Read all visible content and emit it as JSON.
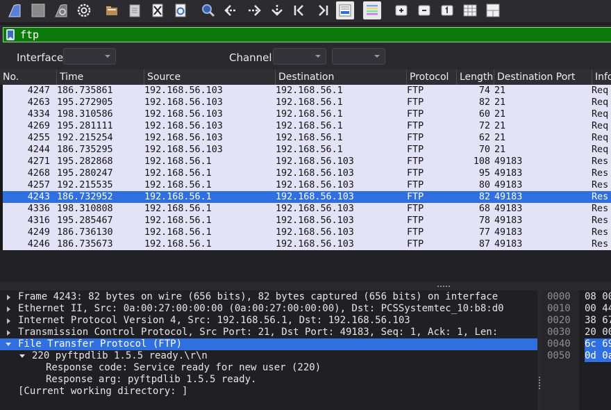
{
  "toolbar": {
    "icons": [
      "shark-fin-start-icon",
      "stop-square-icon",
      "shark-fin-restart-icon",
      "gear-options-icon",
      "open-folder-icon",
      "save-file-icon",
      "close-file-icon",
      "reload-file-icon",
      "find-magnifier-icon",
      "go-back-icon",
      "go-forward-icon",
      "go-to-packet-icon",
      "first-packet-icon",
      "last-packet-icon",
      "autoscroll-icon",
      "colorize-icon",
      "zoom-in-icon",
      "zoom-out-icon",
      "normal-size-icon",
      "resize-columns-icon",
      "layout-icon"
    ]
  },
  "filter": {
    "value": "ftp"
  },
  "interface_bar": {
    "interface_label": "Interface",
    "channel_label": "Channel",
    "interface_value": "",
    "channel_value": "",
    "channel_width_value": ""
  },
  "packet_list": {
    "columns": [
      "No.",
      "Time",
      "Source",
      "Destination",
      "Protocol",
      "Length",
      "Destination Port",
      "Info"
    ],
    "rows": [
      {
        "no": "4247",
        "time": "186.735861",
        "src": "192.168.56.103",
        "dst": "192.168.56.1",
        "proto": "FTP",
        "len": "74",
        "dport": "21",
        "info": "Req"
      },
      {
        "no": "4263",
        "time": "195.272905",
        "src": "192.168.56.103",
        "dst": "192.168.56.1",
        "proto": "FTP",
        "len": "82",
        "dport": "21",
        "info": "Req"
      },
      {
        "no": "4334",
        "time": "198.310586",
        "src": "192.168.56.103",
        "dst": "192.168.56.1",
        "proto": "FTP",
        "len": "60",
        "dport": "21",
        "info": "Req"
      },
      {
        "no": "4269",
        "time": "195.281111",
        "src": "192.168.56.103",
        "dst": "192.168.56.1",
        "proto": "FTP",
        "len": "72",
        "dport": "21",
        "info": "Req"
      },
      {
        "no": "4255",
        "time": "192.215254",
        "src": "192.168.56.103",
        "dst": "192.168.56.1",
        "proto": "FTP",
        "len": "62",
        "dport": "21",
        "info": "Req"
      },
      {
        "no": "4244",
        "time": "186.735295",
        "src": "192.168.56.103",
        "dst": "192.168.56.1",
        "proto": "FTP",
        "len": "70",
        "dport": "21",
        "info": "Req"
      },
      {
        "no": "4271",
        "time": "195.282868",
        "src": "192.168.56.1",
        "dst": "192.168.56.103",
        "proto": "FTP",
        "len": "108",
        "dport": "49183",
        "info": "Res"
      },
      {
        "no": "4268",
        "time": "195.280247",
        "src": "192.168.56.1",
        "dst": "192.168.56.103",
        "proto": "FTP",
        "len": "95",
        "dport": "49183",
        "info": "Res"
      },
      {
        "no": "4257",
        "time": "192.215535",
        "src": "192.168.56.1",
        "dst": "192.168.56.103",
        "proto": "FTP",
        "len": "80",
        "dport": "49183",
        "info": "Res"
      },
      {
        "no": "4243",
        "time": "186.732952",
        "src": "192.168.56.1",
        "dst": "192.168.56.103",
        "proto": "FTP",
        "len": "82",
        "dport": "49183",
        "info": "Res",
        "selected": true
      },
      {
        "no": "4336",
        "time": "198.310808",
        "src": "192.168.56.1",
        "dst": "192.168.56.103",
        "proto": "FTP",
        "len": "68",
        "dport": "49183",
        "info": "Res"
      },
      {
        "no": "4316",
        "time": "195.285467",
        "src": "192.168.56.1",
        "dst": "192.168.56.103",
        "proto": "FTP",
        "len": "78",
        "dport": "49183",
        "info": "Res"
      },
      {
        "no": "4249",
        "time": "186.736130",
        "src": "192.168.56.1",
        "dst": "192.168.56.103",
        "proto": "FTP",
        "len": "77",
        "dport": "49183",
        "info": "Res"
      },
      {
        "no": "4246",
        "time": "186.735673",
        "src": "192.168.56.1",
        "dst": "192.168.56.103",
        "proto": "FTP",
        "len": "87",
        "dport": "49183",
        "info": "Res"
      }
    ]
  },
  "details": {
    "rows": [
      {
        "text": "Frame 4243: 82 bytes on wire (656 bits), 82 bytes captured (656 bits) on interface",
        "level": 0,
        "toggle": "collapsed"
      },
      {
        "text": "Ethernet II, Src: 0a:00:27:00:00:00 (0a:00:27:00:00:00), Dst: PCSSystemtec_10:b8:d0",
        "level": 0,
        "toggle": "collapsed"
      },
      {
        "text": "Internet Protocol Version 4, Src: 192.168.56.1, Dst: 192.168.56.103",
        "level": 0,
        "toggle": "collapsed"
      },
      {
        "text": "Transmission Control Protocol, Src Port: 21, Dst Port: 49183, Seq: 1, Ack: 1, Len:",
        "level": 0,
        "toggle": "collapsed"
      },
      {
        "text": "File Transfer Protocol (FTP)",
        "level": 0,
        "toggle": "expanded",
        "selected": true
      },
      {
        "text": "220 pyftpdlib 1.5.5 ready.\\r\\n",
        "level": 1,
        "toggle": "expanded"
      },
      {
        "text": "Response code: Service ready for new user (220)",
        "level": 2,
        "toggle": "none"
      },
      {
        "text": "Response arg: pyftpdlib 1.5.5 ready.",
        "level": 2,
        "toggle": "none"
      },
      {
        "text": "[Current working directory: ]",
        "level": 0,
        "toggle": "none"
      }
    ]
  },
  "bytes": {
    "offsets": [
      "0000",
      "0010",
      "0020",
      "0030",
      "0040",
      "0050"
    ],
    "hex": [
      "08 00",
      "00 44",
      "38 67",
      "20 00",
      "6c 69",
      "0d 0a"
    ],
    "highlighted_rows": [
      4,
      5
    ]
  },
  "colors": {
    "selection": "#2f6fe0",
    "filter_valid": "#0b7a0b",
    "list_row_bg": "#e3e3f7"
  }
}
